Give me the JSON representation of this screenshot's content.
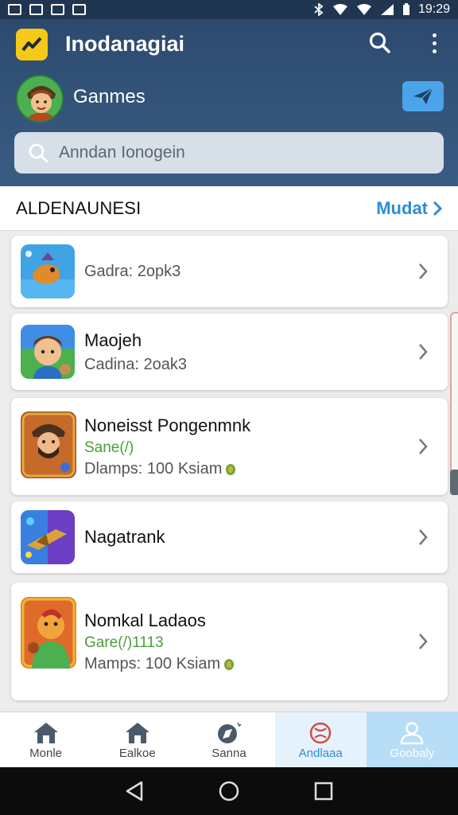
{
  "status_bar": {
    "time": "19:29"
  },
  "header": {
    "app_title": "Inodanagiai",
    "user_name": "Ganmes",
    "search_placeholder": "Anndan Ionogein"
  },
  "section": {
    "title": "ALDENAUNESI",
    "more_label": "Mudat"
  },
  "list_items": [
    {
      "line1": "Gadra: 2opk3"
    },
    {
      "line1": "Maojeh",
      "line2": "Cadina: 2oak3"
    },
    {
      "line1": "Noneisst Pongenmnk",
      "line2": "Sane(/)",
      "line3": "Dlamps: 100 Ksiam"
    },
    {
      "line1": "Nagatrank"
    },
    {
      "line1": "Nomkal Ladaos",
      "line2": "Gare(/)1113",
      "line3": "Mamps: 100 Ksiam"
    }
  ],
  "bottom_nav": [
    {
      "label": "Monle",
      "icon": "home-icon"
    },
    {
      "label": "Ealkoe",
      "icon": "home-icon"
    },
    {
      "label": "Sanna",
      "icon": "compass-icon"
    },
    {
      "label": "Andlaaa",
      "icon": "ball-icon"
    },
    {
      "label": "Goobaly",
      "icon": "profile-icon"
    }
  ],
  "colors": {
    "header_bg": "#2c4a6e",
    "accent_blue": "#2a8ed6",
    "logo_yellow": "#f4c918",
    "green_text": "#4f9c3a"
  }
}
